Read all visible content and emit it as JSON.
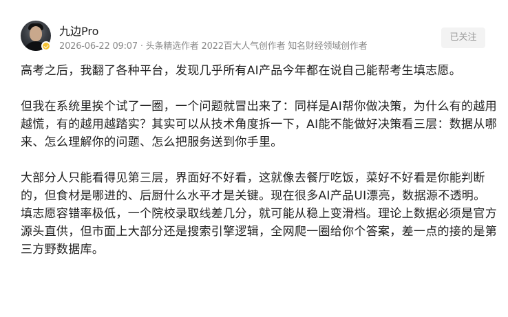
{
  "author": {
    "name": "九边Pro",
    "timestamp": "2026-06-22 09:07",
    "separator": " · ",
    "titles": "头条精选作者 2022百大人气创作者 知名财经领域创作者",
    "follow_label": "已关注"
  },
  "article": {
    "p1": "高考之后，我翻了各种平台，发现几乎所有AI产品今年都在说自己能帮考生填志愿。",
    "p2": "但我在系统里挨个试了一圈，一个问题就冒出来了：同样是AI帮你做决策，为什么有的越用越慌，有的越用越踏实？其实可以从技术角度拆一下，AI能不能做好决策看三层：数据从哪来、怎么理解你的问题、怎么把服务送到你手里。",
    "p3": "大部分人只能看得见第三层，界面好不好看，这就像去餐厅吃饭，菜好不好看是你能判断的，但食材是哪进的、后厨什么水平才是关键。现在很多AI产品UI漂亮，数据源不透明。",
    "p4": "填志愿容错率极低，一个院校录取线差几分，就可能从稳上变滑档。理论上数据必须是官方源头直供，但市面上大部分还是搜索引擎逻辑，全网爬一圈给你个答案，差一点的接的是第三方野数据库。"
  },
  "colors": {
    "text": "#222222",
    "meta": "#8a8a8a",
    "badge": "#f6c232",
    "follow_bg": "#f3f3f3"
  }
}
